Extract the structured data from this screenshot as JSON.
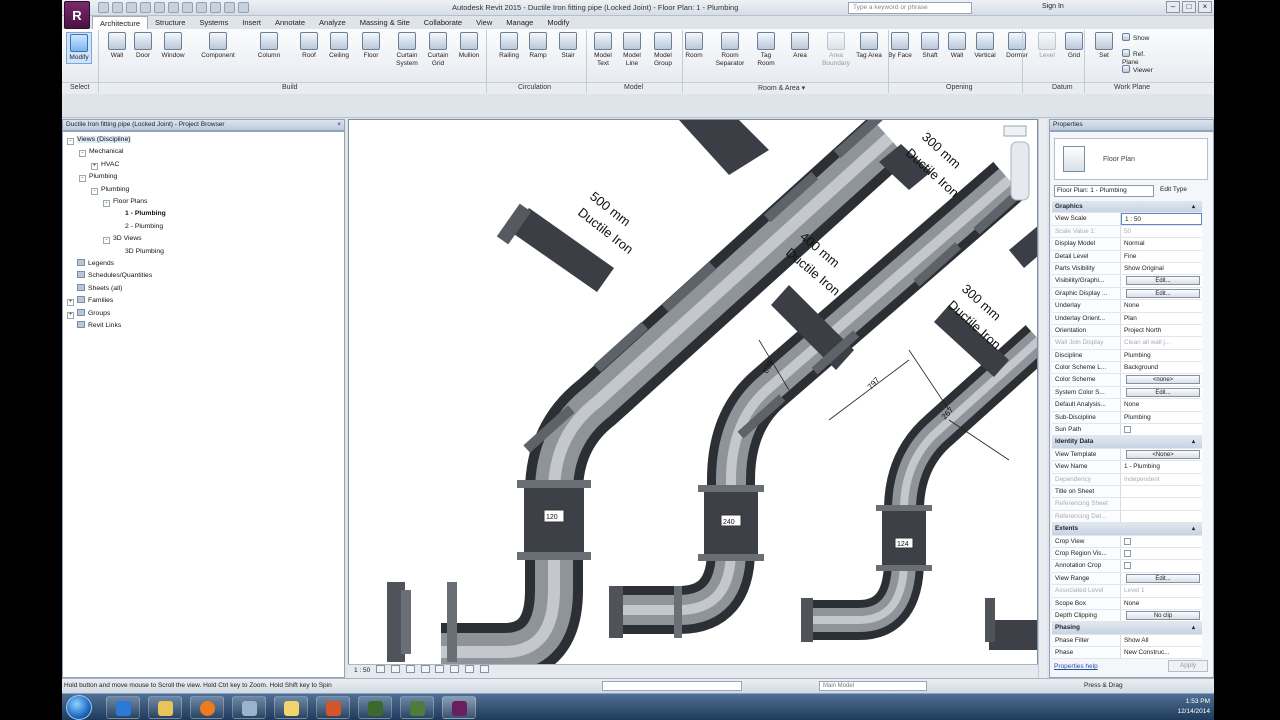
{
  "app": {
    "logo_letter": "R",
    "title": "Autodesk Revit 2015 -  Ductile Iron fitting pipe (Locked Joint) - Floor Plan: 1 - Plumbing",
    "search_placeholder": "Type a keyword or phrase",
    "sign_in": "Sign In"
  },
  "tabs": [
    "Architecture",
    "Structure",
    "Systems",
    "Insert",
    "Annotate",
    "Analyze",
    "Massing & Site",
    "Collaborate",
    "View",
    "Manage",
    "Modify"
  ],
  "ribbon": {
    "tools": [
      "Modify",
      "Wall",
      "Door",
      "Window",
      "Component",
      "Column",
      "Roof",
      "Ceiling",
      "Floor",
      "Curtain System",
      "Curtain Grid",
      "Mullion",
      "Railing",
      "Ramp",
      "Stair",
      "Model Text",
      "Model Line",
      "Model Group",
      "Room",
      "Room Separator",
      "Tag Room",
      "Area",
      "Area Boundary",
      "Tag Area",
      "By Face",
      "Shaft",
      "Wall",
      "Vertical",
      "Dormer",
      "Level",
      "Grid",
      "Set",
      "Show",
      "Ref. Plane",
      "Viewer"
    ],
    "panels": [
      "Select",
      "Build",
      "Circulation",
      "Model",
      "Room & Area ▾",
      "Opening",
      "Datum",
      "Work Plane"
    ]
  },
  "project_browser": {
    "title": "Ductile Iron fitting pipe (Locked Joint) - Project Browser",
    "close": "×",
    "tree": [
      {
        "label": "Views (Discipline)",
        "level": 0,
        "toggle": "-",
        "sel": true
      },
      {
        "label": "Mechanical",
        "level": 1,
        "toggle": "-"
      },
      {
        "label": "HVAC",
        "level": 2,
        "toggle": "+"
      },
      {
        "label": "Plumbing",
        "level": 1,
        "toggle": "-"
      },
      {
        "label": "Plumbing",
        "level": 2,
        "toggle": "-"
      },
      {
        "label": "Floor Plans",
        "level": 3,
        "toggle": "-"
      },
      {
        "label": "1 - Plumbing",
        "level": 4,
        "bold": true
      },
      {
        "label": "2 - Plumbing",
        "level": 4
      },
      {
        "label": "3D Views",
        "level": 3,
        "toggle": "-"
      },
      {
        "label": "3D Plumbing",
        "level": 4
      },
      {
        "label": "Legends",
        "level": 0,
        "icon": true
      },
      {
        "label": "Schedules/Quantities",
        "level": 0,
        "icon": true
      },
      {
        "label": "Sheets (all)",
        "level": 0,
        "icon": true
      },
      {
        "label": "Families",
        "level": 0,
        "toggle": "+",
        "icon": true
      },
      {
        "label": "Groups",
        "level": 0,
        "toggle": "+",
        "icon": true
      },
      {
        "label": "Revit Links",
        "level": 0,
        "icon": true
      }
    ]
  },
  "drawing": {
    "labels": [
      {
        "size": "500 mm",
        "mat": "Ductile Iron"
      },
      {
        "size": "400 mm",
        "mat": "Ductile Iron"
      },
      {
        "size": "300 mm",
        "mat": "Ductile Iron"
      },
      {
        "size": "300 mm",
        "mat": "Ductile Iron"
      }
    ],
    "dims": [
      "839",
      "797",
      "267"
    ],
    "tags": [
      "120",
      "240",
      "124"
    ]
  },
  "view_bar": {
    "scale": "1 : 50"
  },
  "properties": {
    "title": "Properties",
    "type_name": "Floor Plan",
    "filter": "Floor Plan: 1 - Plumbing",
    "edit_type": "Edit Type",
    "rows": [
      {
        "grp": "Graphics"
      },
      {
        "n": "View Scale",
        "v": "1 : 50",
        "sel": true
      },
      {
        "n": "Scale Value  1:",
        "v": "50",
        "dim": true
      },
      {
        "n": "Display Model",
        "v": "Normal"
      },
      {
        "n": "Detail Level",
        "v": "Fine"
      },
      {
        "n": "Parts Visibility",
        "v": "Show Original"
      },
      {
        "n": "Visibility/Graphi...",
        "btn": "Edit..."
      },
      {
        "n": "Graphic Display ...",
        "btn": "Edit..."
      },
      {
        "n": "Underlay",
        "v": "None"
      },
      {
        "n": "Underlay Orient...",
        "v": "Plan"
      },
      {
        "n": "Orientation",
        "v": "Project North"
      },
      {
        "n": "Wall Join Display",
        "v": "Clean all wall j...",
        "dim": true
      },
      {
        "n": "Discipline",
        "v": "Plumbing"
      },
      {
        "n": "Color Scheme L...",
        "v": "Background"
      },
      {
        "n": "Color Scheme",
        "btn": "<none>"
      },
      {
        "n": "System Color S...",
        "btn": "Edit..."
      },
      {
        "n": "Default Analysis...",
        "v": "None"
      },
      {
        "n": "Sub-Discipline",
        "v": "Plumbing"
      },
      {
        "n": "Sun Path",
        "cb": true
      },
      {
        "grp": "Identity Data"
      },
      {
        "n": "View Template",
        "btn": "<None>"
      },
      {
        "n": "View Name",
        "v": "1 - Plumbing"
      },
      {
        "n": "Dependency",
        "v": "Independent",
        "dim": true
      },
      {
        "n": "Title on Sheet",
        "v": ""
      },
      {
        "n": "Referencing Sheet",
        "v": "",
        "dim": true
      },
      {
        "n": "Referencing Det...",
        "v": "",
        "dim": true
      },
      {
        "grp": "Extents"
      },
      {
        "n": "Crop View",
        "cb": true
      },
      {
        "n": "Crop Region Vis...",
        "cb": true
      },
      {
        "n": "Annotation Crop",
        "cb": true
      },
      {
        "n": "View Range",
        "btn": "Edit..."
      },
      {
        "n": "Associated Level",
        "v": "Level 1",
        "dim": true
      },
      {
        "n": "Scope Box",
        "v": "None"
      },
      {
        "n": "Depth Clipping",
        "btn": "No clip"
      },
      {
        "grp": "Phasing"
      },
      {
        "n": "Phase Filter",
        "v": "Show All"
      },
      {
        "n": "Phase",
        "v": "New Construc..."
      }
    ],
    "help": "Properties help",
    "apply": "Apply"
  },
  "status": {
    "hint": "Hold button and move mouse to Scroll the view. Hold Ctrl key to Zoom. Hold Shift key to Spin",
    "main_model": "Main Model",
    "press_drag": "Press & Drag"
  },
  "taskbar": {
    "time": "1:53 PM",
    "date": "12/14/2014"
  },
  "colors": {
    "pipe_dark": "#3c3f44",
    "pipe_mid": "#8a8e95",
    "accent": "#2f68b3"
  }
}
